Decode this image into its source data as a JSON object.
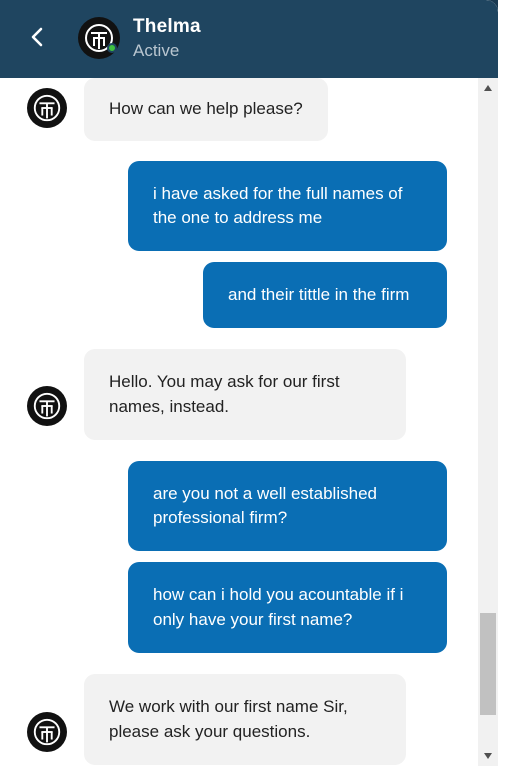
{
  "header": {
    "agent_name": "Thelma",
    "agent_status": "Active",
    "status_color": "#3fc23f"
  },
  "messages": [
    {
      "sender": "bot",
      "text": "How can we help please?"
    },
    {
      "sender": "user",
      "text": "i have asked for the full names of the one to address me"
    },
    {
      "sender": "user",
      "text": "and their tittle in the firm"
    },
    {
      "sender": "bot",
      "text": "Hello. You may ask for our first names, instead."
    },
    {
      "sender": "user",
      "text": "are you not a well established professional firm?"
    },
    {
      "sender": "user",
      "text": "how can i hold you acountable if i only have your first name?"
    },
    {
      "sender": "bot",
      "text": "We work with our first name Sir, please ask your questions."
    }
  ],
  "colors": {
    "header_bg": "#1f4560",
    "user_bubble": "#0a6eb4",
    "bot_bubble": "#f2f2f2"
  },
  "icons": {
    "back": "chevron-left-icon",
    "avatar_logo": "firm-logo-icon",
    "scroll_up": "arrow-up-icon",
    "scroll_down": "arrow-down-icon"
  }
}
